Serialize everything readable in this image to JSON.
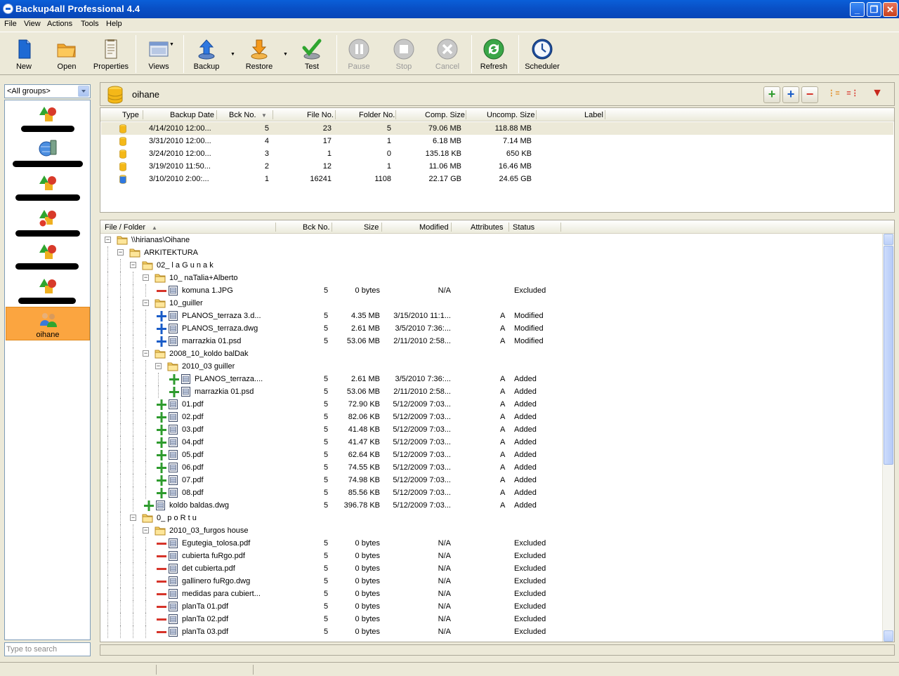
{
  "window": {
    "title": "Backup4all Professional 4.4"
  },
  "menu": [
    "File",
    "View",
    "Actions",
    "Tools",
    "Help"
  ],
  "toolbar": {
    "new": "New",
    "open": "Open",
    "properties": "Properties",
    "views": "Views",
    "backup": "Backup",
    "restore": "Restore",
    "test": "Test",
    "pause": "Pause",
    "stop": "Stop",
    "cancel": "Cancel",
    "refresh": "Refresh",
    "scheduler": "Scheduler"
  },
  "groups": {
    "selected": "<All groups>"
  },
  "jobs": {
    "selected_label": "oihane"
  },
  "search": {
    "placeholder": "Type to search"
  },
  "job": {
    "title": "oihane"
  },
  "backups": {
    "columns": [
      "Type",
      "Backup Date",
      "Bck No.",
      "File No.",
      "Folder No.",
      "Comp. Size",
      "Uncomp. Size",
      "Label"
    ],
    "rows": [
      {
        "date": "4/14/2010 12:00...",
        "bck": "5",
        "files": "23",
        "folders": "5",
        "comp": "79.06 MB",
        "uncomp": "118.88 MB"
      },
      {
        "date": "3/31/2010 12:00...",
        "bck": "4",
        "files": "17",
        "folders": "1",
        "comp": "6.18 MB",
        "uncomp": "7.14 MB"
      },
      {
        "date": "3/24/2010 12:00...",
        "bck": "3",
        "files": "1",
        "folders": "0",
        "comp": "135.18 KB",
        "uncomp": "650 KB"
      },
      {
        "date": "3/19/2010 11:50...",
        "bck": "2",
        "files": "12",
        "folders": "1",
        "comp": "11.06 MB",
        "uncomp": "16.46 MB"
      },
      {
        "date": "3/10/2010 2:00:...",
        "bck": "1",
        "files": "16241",
        "folders": "1108",
        "comp": "22.17 GB",
        "uncomp": "24.65 GB"
      }
    ]
  },
  "files": {
    "columns": [
      "File / Folder",
      "Bck No.",
      "Size",
      "Modified",
      "Attributes",
      "Status"
    ],
    "rows": [
      {
        "depth": 0,
        "kind": "folder",
        "name": "\\\\hirianas\\Oihane"
      },
      {
        "depth": 1,
        "kind": "folder",
        "name": "ARKITEKTURA"
      },
      {
        "depth": 2,
        "kind": "folder",
        "name": "02_ l a G u n a k"
      },
      {
        "depth": 3,
        "kind": "folder",
        "name": "10_ naTalia+Alberto"
      },
      {
        "depth": 4,
        "kind": "file",
        "mark": "minus",
        "name": "komuna 1.JPG",
        "bck": "5",
        "size": "0 bytes",
        "mod": "N/A",
        "attr": "",
        "status": "Excluded"
      },
      {
        "depth": 3,
        "kind": "folder",
        "name": "10_guiller"
      },
      {
        "depth": 4,
        "kind": "file",
        "mark": "blueplus",
        "name": "PLANOS_terraza 3.d...",
        "bck": "5",
        "size": "4.35 MB",
        "mod": "3/15/2010 11:1...",
        "attr": "A",
        "status": "Modified"
      },
      {
        "depth": 4,
        "kind": "file",
        "mark": "blueplus",
        "name": "PLANOS_terraza.dwg",
        "bck": "5",
        "size": "2.61 MB",
        "mod": "3/5/2010 7:36:...",
        "attr": "A",
        "status": "Modified"
      },
      {
        "depth": 4,
        "kind": "file",
        "mark": "blueplus",
        "name": "marrazkia 01.psd",
        "bck": "5",
        "size": "53.06 MB",
        "mod": "2/11/2010 2:58...",
        "attr": "A",
        "status": "Modified"
      },
      {
        "depth": 3,
        "kind": "folder",
        "name": "2008_10_koldo balDak"
      },
      {
        "depth": 4,
        "kind": "folder",
        "name": "2010_03 guiller"
      },
      {
        "depth": 5,
        "kind": "file",
        "mark": "plus",
        "name": "PLANOS_terraza....",
        "bck": "5",
        "size": "2.61 MB",
        "mod": "3/5/2010 7:36:...",
        "attr": "A",
        "status": "Added"
      },
      {
        "depth": 5,
        "kind": "file",
        "mark": "plus",
        "name": "marrazkia 01.psd",
        "bck": "5",
        "size": "53.06 MB",
        "mod": "2/11/2010 2:58...",
        "attr": "A",
        "status": "Added"
      },
      {
        "depth": 4,
        "kind": "file",
        "mark": "plus",
        "name": "01.pdf",
        "bck": "5",
        "size": "72.90 KB",
        "mod": "5/12/2009 7:03...",
        "attr": "A",
        "status": "Added"
      },
      {
        "depth": 4,
        "kind": "file",
        "mark": "plus",
        "name": "02.pdf",
        "bck": "5",
        "size": "82.06 KB",
        "mod": "5/12/2009 7:03...",
        "attr": "A",
        "status": "Added"
      },
      {
        "depth": 4,
        "kind": "file",
        "mark": "plus",
        "name": "03.pdf",
        "bck": "5",
        "size": "41.48 KB",
        "mod": "5/12/2009 7:03...",
        "attr": "A",
        "status": "Added"
      },
      {
        "depth": 4,
        "kind": "file",
        "mark": "plus",
        "name": "04.pdf",
        "bck": "5",
        "size": "41.47 KB",
        "mod": "5/12/2009 7:03...",
        "attr": "A",
        "status": "Added"
      },
      {
        "depth": 4,
        "kind": "file",
        "mark": "plus",
        "name": "05.pdf",
        "bck": "5",
        "size": "62.64 KB",
        "mod": "5/12/2009 7:03...",
        "attr": "A",
        "status": "Added"
      },
      {
        "depth": 4,
        "kind": "file",
        "mark": "plus",
        "name": "06.pdf",
        "bck": "5",
        "size": "74.55 KB",
        "mod": "5/12/2009 7:03...",
        "attr": "A",
        "status": "Added"
      },
      {
        "depth": 4,
        "kind": "file",
        "mark": "plus",
        "name": "07.pdf",
        "bck": "5",
        "size": "74.98 KB",
        "mod": "5/12/2009 7:03...",
        "attr": "A",
        "status": "Added"
      },
      {
        "depth": 4,
        "kind": "file",
        "mark": "plus",
        "name": "08.pdf",
        "bck": "5",
        "size": "85.56 KB",
        "mod": "5/12/2009 7:03...",
        "attr": "A",
        "status": "Added"
      },
      {
        "depth": 3,
        "kind": "file",
        "mark": "plus",
        "name": "koldo baldas.dwg",
        "bck": "5",
        "size": "396.78 KB",
        "mod": "5/12/2009 7:03...",
        "attr": "A",
        "status": "Added"
      },
      {
        "depth": 2,
        "kind": "folder",
        "name": "0_ p o R t u"
      },
      {
        "depth": 3,
        "kind": "folder",
        "name": "2010_03_furgos house"
      },
      {
        "depth": 4,
        "kind": "file",
        "mark": "minus",
        "name": "Egutegia_tolosa.pdf",
        "bck": "5",
        "size": "0 bytes",
        "mod": "N/A",
        "attr": "",
        "status": "Excluded"
      },
      {
        "depth": 4,
        "kind": "file",
        "mark": "minus",
        "name": "cubierta fuRgo.pdf",
        "bck": "5",
        "size": "0 bytes",
        "mod": "N/A",
        "attr": "",
        "status": "Excluded"
      },
      {
        "depth": 4,
        "kind": "file",
        "mark": "minus",
        "name": "det cubierta.pdf",
        "bck": "5",
        "size": "0 bytes",
        "mod": "N/A",
        "attr": "",
        "status": "Excluded"
      },
      {
        "depth": 4,
        "kind": "file",
        "mark": "minus",
        "name": "gallinero fuRgo.dwg",
        "bck": "5",
        "size": "0 bytes",
        "mod": "N/A",
        "attr": "",
        "status": "Excluded"
      },
      {
        "depth": 4,
        "kind": "file",
        "mark": "minus",
        "name": "medidas para cubiert...",
        "bck": "5",
        "size": "0 bytes",
        "mod": "N/A",
        "attr": "",
        "status": "Excluded"
      },
      {
        "depth": 4,
        "kind": "file",
        "mark": "minus",
        "name": "planTa 01.pdf",
        "bck": "5",
        "size": "0 bytes",
        "mod": "N/A",
        "attr": "",
        "status": "Excluded"
      },
      {
        "depth": 4,
        "kind": "file",
        "mark": "minus",
        "name": "planTa 02.pdf",
        "bck": "5",
        "size": "0 bytes",
        "mod": "N/A",
        "attr": "",
        "status": "Excluded"
      },
      {
        "depth": 4,
        "kind": "file",
        "mark": "minus",
        "name": "planTa 03.pdf",
        "bck": "5",
        "size": "0 bytes",
        "mod": "N/A",
        "attr": "",
        "status": "Excluded"
      }
    ]
  },
  "colors": {
    "added": "#2e9b2e",
    "modified": "#1a5cc8",
    "excluded": "#d6342a",
    "selected_job": "#fba540"
  }
}
